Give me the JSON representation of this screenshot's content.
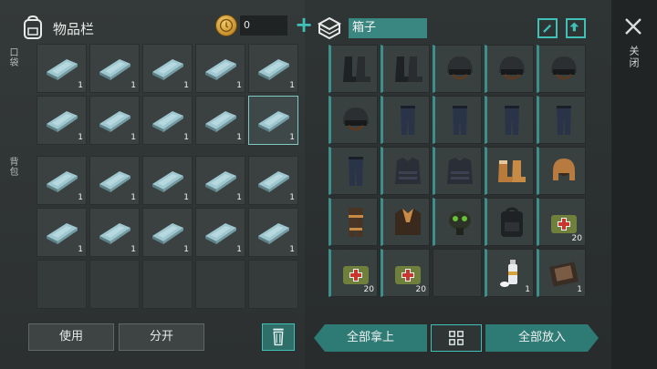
{
  "inventory": {
    "title": "物品栏",
    "coin_count": "0",
    "pocket_label": "口袋",
    "backpack_label": "背包",
    "pocket_slots": [
      {
        "item": "iron-bar",
        "qty": "1"
      },
      {
        "item": "iron-bar",
        "qty": "1"
      },
      {
        "item": "iron-bar",
        "qty": "1"
      },
      {
        "item": "iron-bar",
        "qty": "1"
      },
      {
        "item": "iron-bar",
        "qty": "1"
      },
      {
        "item": "iron-bar",
        "qty": "1"
      },
      {
        "item": "iron-bar",
        "qty": "1"
      },
      {
        "item": "iron-bar",
        "qty": "1"
      },
      {
        "item": "iron-bar",
        "qty": "1"
      },
      {
        "item": "iron-bar",
        "qty": "1",
        "selected": true
      }
    ],
    "backpack_slots": [
      {
        "item": "iron-bar",
        "qty": "1"
      },
      {
        "item": "iron-bar",
        "qty": "1"
      },
      {
        "item": "iron-bar",
        "qty": "1"
      },
      {
        "item": "iron-bar",
        "qty": "1"
      },
      {
        "item": "iron-bar",
        "qty": "1"
      },
      {
        "item": "iron-bar",
        "qty": "1"
      },
      {
        "item": "iron-bar",
        "qty": "1"
      },
      {
        "item": "iron-bar",
        "qty": "1"
      },
      {
        "item": "iron-bar",
        "qty": "1"
      },
      {
        "item": "iron-bar",
        "qty": "1"
      },
      {
        "item": "",
        "qty": ""
      },
      {
        "item": "",
        "qty": ""
      },
      {
        "item": "",
        "qty": ""
      },
      {
        "item": "",
        "qty": ""
      },
      {
        "item": "",
        "qty": ""
      }
    ],
    "use_label": "使用",
    "split_label": "分开"
  },
  "container": {
    "title": "箱子",
    "slots": [
      {
        "item": "boots",
        "qty": ""
      },
      {
        "item": "boots",
        "qty": ""
      },
      {
        "item": "helmet",
        "qty": ""
      },
      {
        "item": "helmet",
        "qty": ""
      },
      {
        "item": "helmet",
        "qty": ""
      },
      {
        "item": "helmet",
        "qty": ""
      },
      {
        "item": "pants",
        "qty": ""
      },
      {
        "item": "pants",
        "qty": ""
      },
      {
        "item": "pants",
        "qty": ""
      },
      {
        "item": "pants",
        "qty": ""
      },
      {
        "item": "pants",
        "qty": ""
      },
      {
        "item": "vest",
        "qty": ""
      },
      {
        "item": "vest",
        "qty": ""
      },
      {
        "item": "fur-boots",
        "qty": ""
      },
      {
        "item": "fur-hat",
        "qty": ""
      },
      {
        "item": "fur-pants",
        "qty": ""
      },
      {
        "item": "fur-jacket",
        "qty": ""
      },
      {
        "item": "gas-mask",
        "qty": ""
      },
      {
        "item": "backpack",
        "qty": ""
      },
      {
        "item": "medkit",
        "qty": "20"
      },
      {
        "item": "medkit",
        "qty": "20"
      },
      {
        "item": "medkit",
        "qty": "20"
      },
      {
        "item": "",
        "qty": ""
      },
      {
        "item": "spray-can",
        "qty": "1"
      },
      {
        "item": "notebook",
        "qty": "1"
      }
    ],
    "take_all_label": "全部拿上",
    "put_all_label": "全部放入"
  },
  "close_label": "关闭",
  "colors": {
    "accent": "#3fc1b8",
    "accent_dark": "#2e7a74",
    "coin": "#d9a441"
  }
}
